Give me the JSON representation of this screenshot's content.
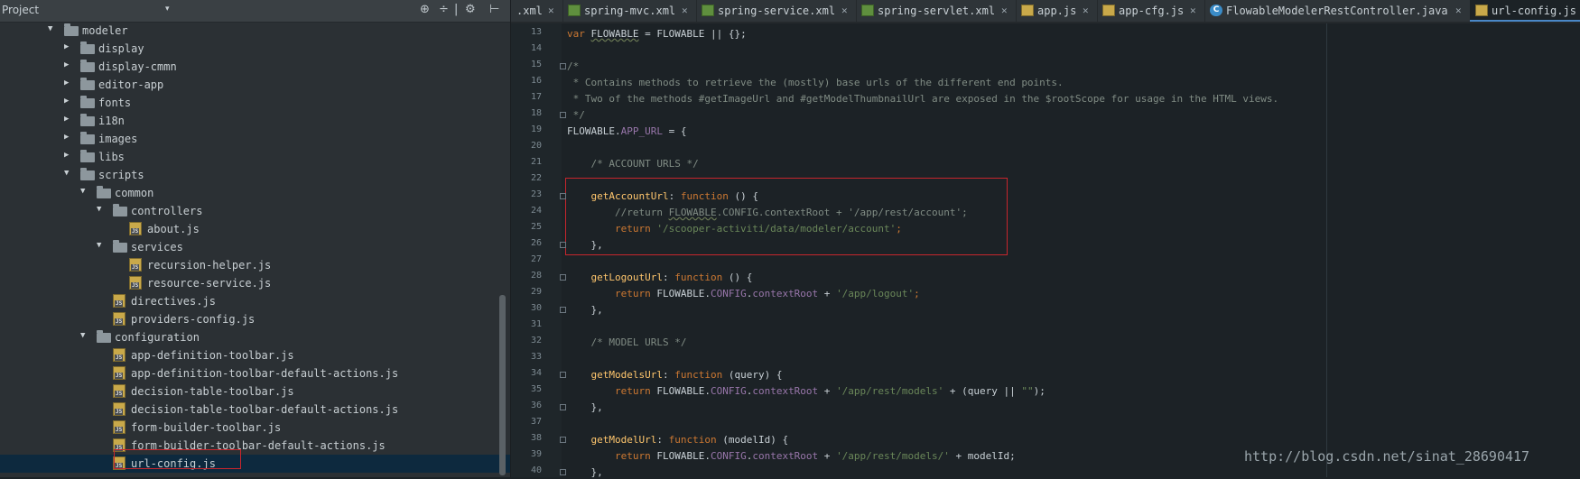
{
  "project_panel": {
    "title": "Project",
    "dropdown_glyph": "▾",
    "toolbar_icons": [
      "settings-target-icon",
      "split-icon",
      "collapse-icon",
      "gear-icon",
      "hide-icon"
    ],
    "tree": [
      {
        "label": "modeler",
        "type": "folder",
        "depth": 0,
        "expanded": true
      },
      {
        "label": "display",
        "type": "folder",
        "depth": 1,
        "expanded": false
      },
      {
        "label": "display-cmmn",
        "type": "folder",
        "depth": 1,
        "expanded": false
      },
      {
        "label": "editor-app",
        "type": "folder",
        "depth": 1,
        "expanded": false
      },
      {
        "label": "fonts",
        "type": "folder",
        "depth": 1,
        "expanded": false
      },
      {
        "label": "i18n",
        "type": "folder",
        "depth": 1,
        "expanded": false
      },
      {
        "label": "images",
        "type": "folder",
        "depth": 1,
        "expanded": false
      },
      {
        "label": "libs",
        "type": "folder",
        "depth": 1,
        "expanded": false
      },
      {
        "label": "scripts",
        "type": "folder",
        "depth": 1,
        "expanded": true
      },
      {
        "label": "common",
        "type": "folder",
        "depth": 2,
        "expanded": true
      },
      {
        "label": "controllers",
        "type": "folder",
        "depth": 3,
        "expanded": true
      },
      {
        "label": "about.js",
        "type": "js",
        "depth": 4
      },
      {
        "label": "services",
        "type": "folder",
        "depth": 3,
        "expanded": true
      },
      {
        "label": "recursion-helper.js",
        "type": "js",
        "depth": 4
      },
      {
        "label": "resource-service.js",
        "type": "js",
        "depth": 4
      },
      {
        "label": "directives.js",
        "type": "js",
        "depth": 3
      },
      {
        "label": "providers-config.js",
        "type": "js",
        "depth": 3
      },
      {
        "label": "configuration",
        "type": "folder",
        "depth": 2,
        "expanded": true
      },
      {
        "label": "app-definition-toolbar.js",
        "type": "js",
        "depth": 3
      },
      {
        "label": "app-definition-toolbar-default-actions.js",
        "type": "js",
        "depth": 3
      },
      {
        "label": "decision-table-toolbar.js",
        "type": "js",
        "depth": 3
      },
      {
        "label": "decision-table-toolbar-default-actions.js",
        "type": "js",
        "depth": 3
      },
      {
        "label": "form-builder-toolbar.js",
        "type": "js",
        "depth": 3
      },
      {
        "label": "form-builder-toolbar-default-actions.js",
        "type": "js",
        "depth": 3
      },
      {
        "label": "url-config.js",
        "type": "js",
        "depth": 3,
        "selected": true
      }
    ]
  },
  "editor": {
    "tabs": [
      {
        "label": ".xml",
        "icon": "none",
        "active": false
      },
      {
        "label": "spring-mvc.xml",
        "icon": "xml",
        "active": false
      },
      {
        "label": "spring-service.xml",
        "icon": "xml",
        "active": false
      },
      {
        "label": "spring-servlet.xml",
        "icon": "xml",
        "active": false
      },
      {
        "label": "app.js",
        "icon": "js",
        "active": false
      },
      {
        "label": "app-cfg.js",
        "icon": "js",
        "active": false
      },
      {
        "label": "FlowableModelerRestController.java",
        "icon": "java",
        "active": false
      },
      {
        "label": "url-config.js",
        "icon": "js",
        "active": true
      }
    ],
    "line_numbers": [
      "13",
      "14",
      "15",
      "16",
      "17",
      "18",
      "19",
      "20",
      "21",
      "22",
      "23",
      "24",
      "25",
      "26",
      "27",
      "28",
      "29",
      "30",
      "31",
      "32",
      "33",
      "34",
      "35",
      "36",
      "37",
      "38",
      "39",
      "40"
    ],
    "code_lines": [
      [
        {
          "t": "var ",
          "c": "kw"
        },
        {
          "t": "FLOWABLE",
          "c": "df ul"
        },
        {
          "t": " = FLOWABLE || {};",
          "c": "df"
        }
      ],
      [],
      [
        {
          "t": "/*",
          "c": "cm"
        }
      ],
      [
        {
          "t": " * Contains methods to retrieve the (mostly) base urls of the different end points.",
          "c": "cm"
        }
      ],
      [
        {
          "t": " * Two of the methods #getImageUrl and #getModelThumbnailUrl are exposed in the $rootScope for usage in the HTML views.",
          "c": "cm"
        }
      ],
      [
        {
          "t": " */",
          "c": "cm"
        }
      ],
      [
        {
          "t": "FLOWABLE.",
          "c": "df"
        },
        {
          "t": "APP_URL",
          "c": "pr"
        },
        {
          "t": " = {",
          "c": "df"
        }
      ],
      [],
      [
        {
          "t": "    /* ACCOUNT URLS */",
          "c": "cm"
        }
      ],
      [],
      [
        {
          "t": "    ",
          "c": "df"
        },
        {
          "t": "getAccountUrl",
          "c": "fn"
        },
        {
          "t": ": ",
          "c": "df"
        },
        {
          "t": "function",
          "c": "kw"
        },
        {
          "t": " () {",
          "c": "df"
        }
      ],
      [
        {
          "t": "        //return ",
          "c": "cm"
        },
        {
          "t": "FLOWABLE",
          "c": "cm ul"
        },
        {
          "t": ".CONFIG.contextRoot + '/app/rest/account';",
          "c": "cm"
        }
      ],
      [
        {
          "t": "        ",
          "c": "df"
        },
        {
          "t": "return ",
          "c": "kw"
        },
        {
          "t": "'/scooper-activiti/data/modeler/account'",
          "c": "str"
        },
        {
          "t": ";",
          "c": "kw"
        }
      ],
      [
        {
          "t": "    },",
          "c": "df"
        }
      ],
      [],
      [
        {
          "t": "    ",
          "c": "df"
        },
        {
          "t": "getLogoutUrl",
          "c": "fn"
        },
        {
          "t": ": ",
          "c": "df"
        },
        {
          "t": "function",
          "c": "kw"
        },
        {
          "t": " () {",
          "c": "df"
        }
      ],
      [
        {
          "t": "        ",
          "c": "df"
        },
        {
          "t": "return ",
          "c": "kw"
        },
        {
          "t": "FLOWABLE.",
          "c": "df"
        },
        {
          "t": "CONFIG",
          "c": "pr"
        },
        {
          "t": ".",
          "c": "df"
        },
        {
          "t": "contextRoot",
          "c": "pr"
        },
        {
          "t": " + ",
          "c": "df"
        },
        {
          "t": "'/app/logout'",
          "c": "str"
        },
        {
          "t": ";",
          "c": "kw"
        }
      ],
      [
        {
          "t": "    },",
          "c": "df"
        }
      ],
      [],
      [
        {
          "t": "    /* MODEL URLS */",
          "c": "cm"
        }
      ],
      [],
      [
        {
          "t": "    ",
          "c": "df"
        },
        {
          "t": "getModelsUrl",
          "c": "fn"
        },
        {
          "t": ": ",
          "c": "df"
        },
        {
          "t": "function",
          "c": "kw"
        },
        {
          "t": " (query) {",
          "c": "df"
        }
      ],
      [
        {
          "t": "        ",
          "c": "df"
        },
        {
          "t": "return ",
          "c": "kw"
        },
        {
          "t": "FLOWABLE.",
          "c": "df"
        },
        {
          "t": "CONFIG",
          "c": "pr"
        },
        {
          "t": ".",
          "c": "df"
        },
        {
          "t": "contextRoot",
          "c": "pr"
        },
        {
          "t": " + ",
          "c": "df"
        },
        {
          "t": "'/app/rest/models'",
          "c": "str"
        },
        {
          "t": " + (query || ",
          "c": "df"
        },
        {
          "t": "\"\"",
          "c": "str"
        },
        {
          "t": ");",
          "c": "df"
        }
      ],
      [
        {
          "t": "    },",
          "c": "df"
        }
      ],
      [],
      [
        {
          "t": "    ",
          "c": "df"
        },
        {
          "t": "getModelUrl",
          "c": "fn"
        },
        {
          "t": ": ",
          "c": "df"
        },
        {
          "t": "function",
          "c": "kw"
        },
        {
          "t": " (modelId) {",
          "c": "df"
        }
      ],
      [
        {
          "t": "        ",
          "c": "df"
        },
        {
          "t": "return ",
          "c": "kw"
        },
        {
          "t": "FLOWABLE.",
          "c": "df"
        },
        {
          "t": "CONFIG",
          "c": "pr"
        },
        {
          "t": ".",
          "c": "df"
        },
        {
          "t": "contextRoot",
          "c": "pr"
        },
        {
          "t": " + ",
          "c": "df"
        },
        {
          "t": "'/app/rest/models/'",
          "c": "str"
        },
        {
          "t": " + modelId;",
          "c": "df"
        }
      ],
      [
        {
          "t": "    },",
          "c": "df"
        }
      ]
    ]
  },
  "watermark": "http://blog.csdn.net/sinat_28690417"
}
